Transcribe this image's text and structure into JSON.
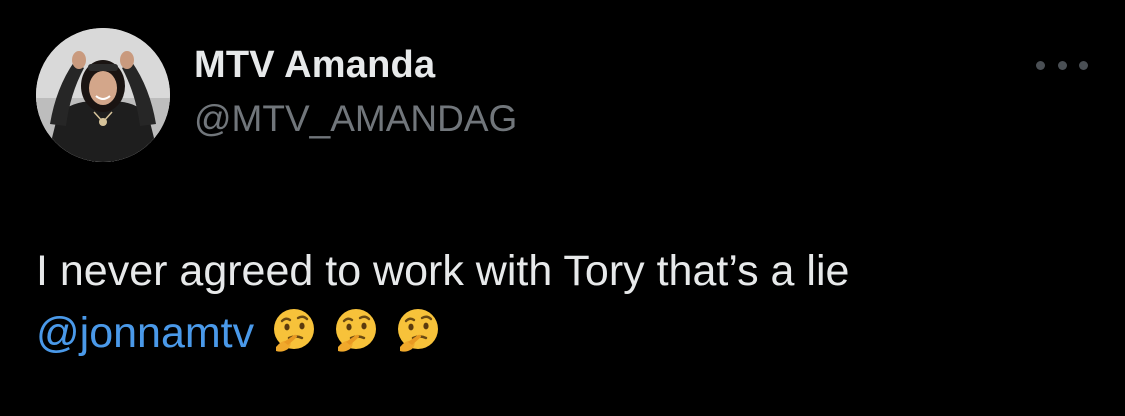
{
  "user": {
    "display_name": "MTV Amanda",
    "handle": "@MTV_AMANDAG",
    "avatar_icon": "profile-photo"
  },
  "menu": {
    "icon": "more-options-icon"
  },
  "tweet": {
    "text": "I never agreed to work with Tory that’s a lie",
    "mention": "@jonnamtv",
    "emojis": [
      "thinking-face-emoji",
      "thinking-face-emoji",
      "thinking-face-emoji"
    ]
  },
  "colors": {
    "background": "#000000",
    "name": "#e7e9ea",
    "handle": "#71767b",
    "mention": "#4a99e9"
  }
}
